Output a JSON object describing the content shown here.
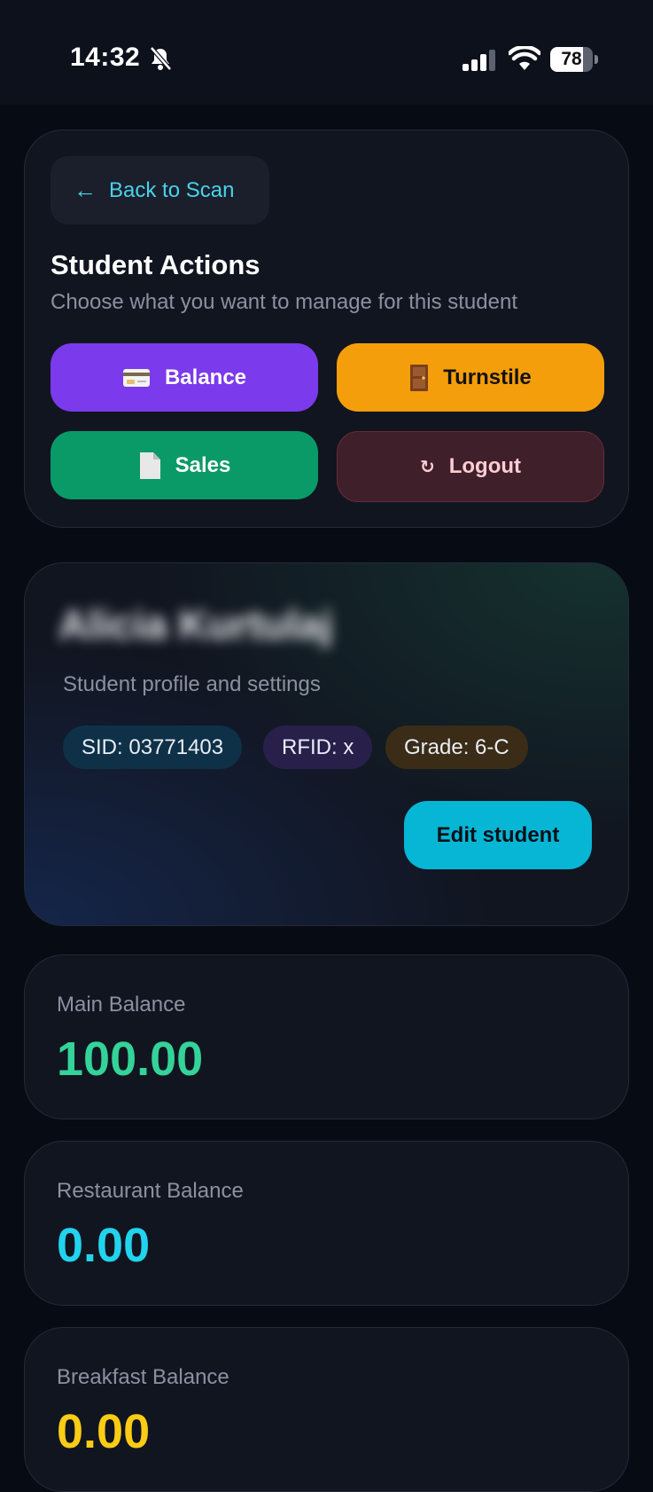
{
  "status_bar": {
    "time": "14:32",
    "battery": "78",
    "battery_level": 0.78
  },
  "actions": {
    "back_label": "Back to Scan",
    "title": "Student Actions",
    "subtitle": "Choose what you want to manage for this student",
    "buttons": {
      "balance": "Balance",
      "turnstile": "Turnstile",
      "sales": "Sales",
      "logout": "Logout"
    }
  },
  "profile": {
    "name": "Alicia Kurtulaj",
    "subtitle": "Student profile and settings",
    "sid": "SID: 03771403",
    "rfid": "RFID: x",
    "grade": "Grade: 6-C",
    "edit_label": "Edit student"
  },
  "balances": [
    {
      "label": "Main Balance",
      "value": "100.00",
      "color": "#34d399"
    },
    {
      "label": "Restaurant Balance",
      "value": "0.00",
      "color": "#22d3ee"
    },
    {
      "label": "Breakfast Balance",
      "value": "0.00",
      "color": "#facc15"
    }
  ],
  "colors": {
    "background": "#070b14",
    "accent_purple": "#7b3aeb",
    "accent_amber": "#f59e0b",
    "accent_green": "#0a9a68",
    "accent_cyan": "#06b6d4"
  }
}
